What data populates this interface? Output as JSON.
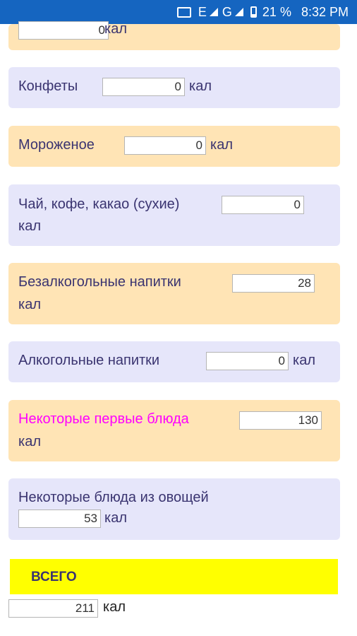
{
  "status_bar": {
    "network_e": "E",
    "network_g": "G",
    "battery": "21 %",
    "time": "8:32 PM"
  },
  "unit": "кал",
  "items": [
    {
      "label": "",
      "value": "0"
    },
    {
      "label": "Конфеты",
      "value": "0"
    },
    {
      "label": "Мороженое",
      "value": "0"
    },
    {
      "label": "Чай, кофе, какао (сухие)",
      "value": "0"
    },
    {
      "label": "Безалкогольные напитки",
      "value": "28"
    },
    {
      "label": "Алкогольные напитки",
      "value": "0"
    },
    {
      "label": "Некоторые первые блюда",
      "value": "130"
    },
    {
      "label": "Некоторые блюда из овощей",
      "value": "53"
    }
  ],
  "total": {
    "label": "ВСЕГО",
    "value": "211"
  },
  "colors": {
    "orange_card": "#ffe4b5",
    "lavender_card": "#e6e6fa",
    "total_bar": "#ffff00",
    "highlight_label": "#ff00ff",
    "status_bar": "#1565c0"
  }
}
